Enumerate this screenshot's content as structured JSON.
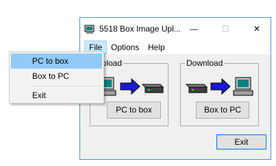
{
  "window": {
    "title": "5518 Box Image Upl...",
    "controls": {
      "minimize": "—",
      "maximize": "☐",
      "close": "✕"
    }
  },
  "menubar": {
    "file": "File",
    "options": "Options",
    "help": "Help"
  },
  "upload": {
    "label": "Upload",
    "button": "PC to box"
  },
  "download": {
    "label": "Download",
    "button": "Box to PC"
  },
  "exit_button": "Exit",
  "file_menu": {
    "items": [
      "PC to box",
      "Box to PC",
      "Exit"
    ],
    "highlighted": "PC to box"
  },
  "colors": {
    "accent": "#0078d7",
    "highlight": "#91c9f7",
    "arrow": "#1a1acc"
  }
}
